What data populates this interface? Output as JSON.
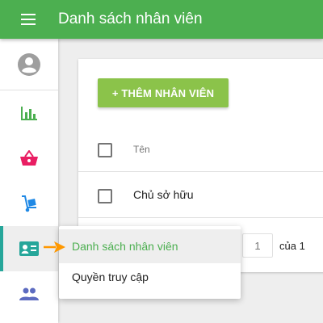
{
  "app": {
    "title": "Danh sách nhân viên",
    "menu_icon": "hamburger-menu-icon",
    "colors": {
      "appbar": "#4caf50",
      "accent_button": "#8bc34a",
      "active_indicator": "#26a69a",
      "pointer": "#ff9800"
    }
  },
  "sidebar": {
    "items": [
      {
        "icon": "account-circle-icon",
        "color": "#9e9e9e"
      },
      {
        "icon": "bar-chart-icon",
        "color": "#4caf50"
      },
      {
        "icon": "shopping-basket-icon",
        "color": "#e91e63"
      },
      {
        "icon": "hand-truck-icon",
        "color": "#1e88e5"
      },
      {
        "icon": "id-card-icon",
        "color": "#26a69a",
        "active": true
      },
      {
        "icon": "people-icon",
        "color": "#5c6bc0"
      }
    ]
  },
  "main": {
    "add_button": "+ THÊM NHÂN VIÊN",
    "table": {
      "columns": [
        "Tên"
      ],
      "rows": [
        [
          "Chủ sở hữu"
        ]
      ]
    },
    "pagination": {
      "page": "1",
      "total_label": "của 1"
    }
  },
  "submenu": {
    "items": [
      {
        "label": "Danh sách nhân viên",
        "selected": true
      },
      {
        "label": "Quyền truy cập",
        "selected": false
      }
    ]
  }
}
